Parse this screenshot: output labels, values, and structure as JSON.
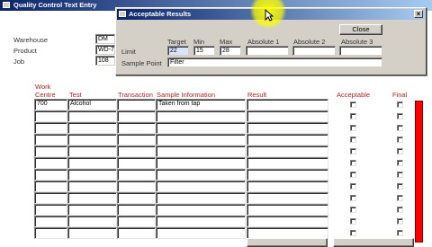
{
  "main_window": {
    "title": "Quality Control Text Entry",
    "warehouse_label": "Warehouse",
    "warehouse_value": "DM",
    "product_label": "Product",
    "product_value": "WD-7",
    "job_label": "Job",
    "job_value": "108"
  },
  "grid": {
    "headers": {
      "work_centre": "Work\nCentre",
      "test": "Test",
      "transaction": "Transaction",
      "sample_information": "Sample Information",
      "result": "Result",
      "acceptable": "Acceptable",
      "final": "Final"
    },
    "rows": [
      {
        "work_centre": "700",
        "test": "Alcohol",
        "transaction": "",
        "sample_information": "Taken from tap",
        "result": ""
      },
      {
        "work_centre": "",
        "test": "",
        "transaction": "",
        "sample_information": "",
        "result": ""
      },
      {
        "work_centre": "",
        "test": "",
        "transaction": "",
        "sample_information": "",
        "result": ""
      },
      {
        "work_centre": "",
        "test": "",
        "transaction": "",
        "sample_information": "",
        "result": ""
      },
      {
        "work_centre": "",
        "test": "",
        "transaction": "",
        "sample_information": "",
        "result": ""
      },
      {
        "work_centre": "",
        "test": "",
        "transaction": "",
        "sample_information": "",
        "result": ""
      },
      {
        "work_centre": "",
        "test": "",
        "transaction": "",
        "sample_information": "",
        "result": ""
      },
      {
        "work_centre": "",
        "test": "",
        "transaction": "",
        "sample_information": "",
        "result": ""
      },
      {
        "work_centre": "",
        "test": "",
        "transaction": "",
        "sample_information": "",
        "result": ""
      },
      {
        "work_centre": "",
        "test": "",
        "transaction": "",
        "sample_information": "",
        "result": ""
      },
      {
        "work_centre": "",
        "test": "",
        "transaction": "",
        "sample_information": "",
        "result": ""
      },
      {
        "work_centre": "",
        "test": "",
        "transaction": "",
        "sample_information": "",
        "result": ""
      }
    ]
  },
  "dialog": {
    "title": "Acceptable Results",
    "close_button": "Close",
    "col_target": "Target",
    "col_min": "Min",
    "col_max": "Max",
    "col_absolute1": "Absolute 1",
    "col_absolute2": "Absolute 2",
    "col_absolute3": "Absolute 3",
    "limit_label": "Limit",
    "limit_target": "22",
    "limit_min": "15",
    "limit_max": "28",
    "limit_absolute1": "",
    "limit_absolute2": "",
    "limit_absolute3": "",
    "sample_point_label": "Sample Point",
    "sample_point_value": "Filter"
  },
  "colors": {
    "title_gradient_start": "#0a246a",
    "title_gradient_end": "#a6caf0",
    "header_red": "#b22222",
    "scrollbar_red": "#ff0000",
    "cursor_highlight": "#ffff00"
  },
  "icons": {
    "window_icon": "app-window-icon",
    "close_x": "close-icon",
    "cursor": "mouse-pointer-icon"
  }
}
